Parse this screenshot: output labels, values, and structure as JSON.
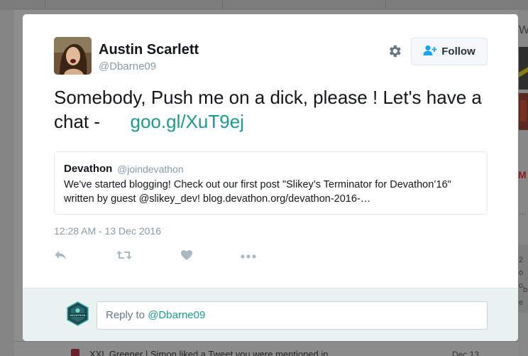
{
  "background": {
    "right_title": "W",
    "right_snippets": [
      "2",
      "o",
      "o",
      "bs",
      "e"
    ],
    "notification_text": "XXL Greener | Simon liked a Tweet you were mentioned in",
    "notification_date": "Dec 13"
  },
  "tweet": {
    "author_name": "Austin Scarlett",
    "author_handle": "@Dbarne09",
    "text": "Somebody, Push me on a dick, please !  Let's have a chat -",
    "link": "goo.gl/XuT9ej",
    "timestamp": "12:28 AM - 13 Dec 2016"
  },
  "follow_button": {
    "label": "Follow",
    "icon": "add-user-icon"
  },
  "settings_icon": "gear-icon",
  "quoted_tweet": {
    "author_name": "Devathon",
    "author_handle": "@joindevathon",
    "text": "We've started blogging! Check out our first post \"Slikey’s Terminator for Devathon’16\" written by guest @slikey_dev! blog.devathon.org/devathon-2016-…"
  },
  "actions": [
    {
      "name": "reply",
      "icon": "reply-icon"
    },
    {
      "name": "retweet",
      "icon": "retweet-icon"
    },
    {
      "name": "like",
      "icon": "heart-icon"
    },
    {
      "name": "more",
      "icon": "more-dots-icon"
    }
  ],
  "reply_box": {
    "prefix": "Reply to ",
    "mention": "@Dbarne09",
    "avatar_label": "DEVATHON"
  },
  "colors": {
    "accent": "#1b9b8e",
    "text": "#14171a",
    "muted": "#8899a6",
    "reply_bg": "#e9f2f1"
  }
}
